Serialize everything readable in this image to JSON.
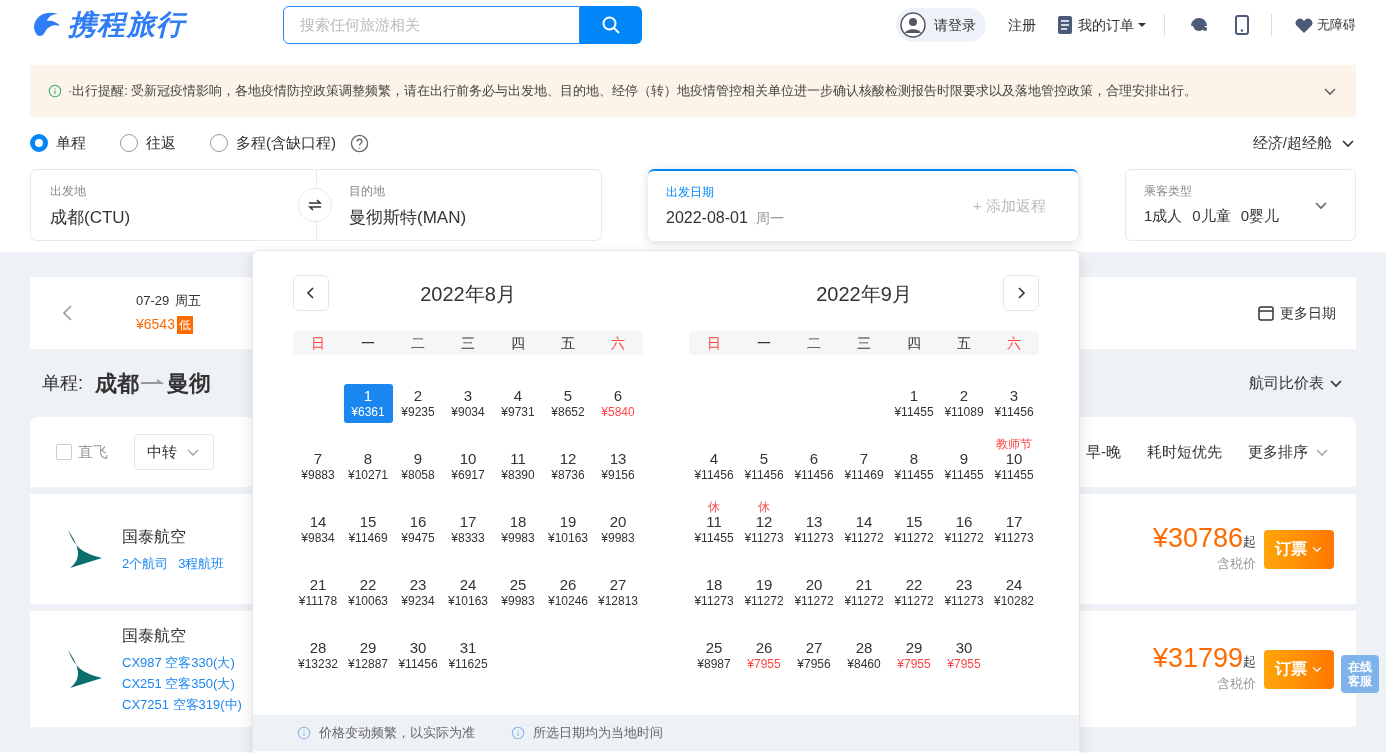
{
  "header": {
    "logo": "携程旅行",
    "search": {
      "placeholder": "搜索任何旅游相关"
    },
    "login": "请登录",
    "register": "注册",
    "orders": "我的订单",
    "accessibility": "无障碍"
  },
  "notice": {
    "text": "·出行提醒: 受新冠疫情影响，各地疫情防控政策调整频繁，请在出行前务必与出发地、目的地、经停（转）地疫情管控相关单位进一步确认核酸检测报告时限要求以及落地管控政策，合理安排出行。"
  },
  "trip_types": [
    {
      "label": "单程",
      "selected": true
    },
    {
      "label": "往返",
      "selected": false
    },
    {
      "label": "多程(含缺口程)",
      "selected": false
    }
  ],
  "cabin": "经济/超经舱",
  "search_form": {
    "from": {
      "label": "出发地",
      "value": "成都(CTU)"
    },
    "to": {
      "label": "目的地",
      "value": "曼彻斯特(MAN)"
    },
    "date": {
      "label": "出发日期",
      "value": "2022-08-01",
      "weekday": "周一",
      "return": "+ 添加返程"
    },
    "passengers": {
      "label": "乘客类型",
      "value": [
        "1成人",
        "0儿童",
        "0婴儿"
      ]
    }
  },
  "date_strip": {
    "date": "07-29",
    "weekday": "周五",
    "price": "¥6543",
    "badge": "低",
    "more": "更多日期"
  },
  "route": {
    "label": "单程:",
    "from": "成都",
    "to": "曼彻",
    "compare": "航司比价表"
  },
  "filters": {
    "direct": {
      "label": "直飞",
      "checked": false
    },
    "dropdowns": [
      "中转"
    ],
    "sorts": [
      "早-晚",
      "耗时短优先",
      "更多排序"
    ]
  },
  "flights": [
    {
      "airline": "国泰航空",
      "details": [
        "2个航司",
        "3程航班"
      ],
      "price": "¥30786",
      "suffix": "起",
      "tax": "含税价",
      "book": "订票"
    },
    {
      "airline": "国泰航空",
      "details": [
        "CX987 空客330(大)",
        "CX251 空客350(大)",
        "CX7251 空客319(中)"
      ],
      "price": "¥31799",
      "suffix": "起",
      "tax": "含税价",
      "book": "订票"
    }
  ],
  "service": "在线客服",
  "calendar": {
    "months": [
      {
        "title": "2022年8月",
        "weekdays": [
          {
            "label": "日",
            "weekend": true
          },
          {
            "label": "一",
            "weekend": false
          },
          {
            "label": "二",
            "weekend": false
          },
          {
            "label": "三",
            "weekend": false
          },
          {
            "label": "四",
            "weekend": false
          },
          {
            "label": "五",
            "weekend": false
          },
          {
            "label": "六",
            "weekend": true
          }
        ],
        "weeks": [
          {
            "align_end": true,
            "days": [
              {
                "day": "1",
                "price": "¥6361",
                "selected": true
              },
              {
                "day": "2",
                "price": "¥9235",
                "low": false,
                "selected": false
              },
              {
                "day": "3",
                "price": "¥9034",
                "low": false,
                "selected": false
              },
              {
                "day": "4",
                "price": "¥9731",
                "low": false,
                "selected": false
              },
              {
                "day": "5",
                "price": "¥8652",
                "low": false,
                "selected": false
              },
              {
                "day": "6",
                "price": "¥5840",
                "low": true,
                "selected": false
              }
            ]
          },
          {
            "days": [
              {
                "day": "7",
                "price": "¥9883",
                "low": false,
                "selected": false
              },
              {
                "day": "8",
                "price": "¥10271",
                "low": false,
                "selected": false
              },
              {
                "day": "9",
                "price": "¥8058",
                "low": false,
                "selected": false
              },
              {
                "day": "10",
                "price": "¥6917",
                "low": false,
                "selected": false
              },
              {
                "day": "11",
                "price": "¥8390",
                "low": false,
                "selected": false
              },
              {
                "day": "12",
                "price": "¥8736",
                "low": false,
                "selected": false
              },
              {
                "day": "13",
                "price": "¥9156",
                "low": false,
                "selected": false
              }
            ]
          },
          {
            "days": [
              {
                "day": "14",
                "price": "¥9834",
                "low": false,
                "selected": false
              },
              {
                "day": "15",
                "price": "¥11469",
                "low": false,
                "selected": false
              },
              {
                "day": "16",
                "price": "¥9475",
                "low": false,
                "selected": false
              },
              {
                "day": "17",
                "price": "¥8333",
                "low": false,
                "selected": false
              },
              {
                "day": "18",
                "price": "¥9983",
                "low": false,
                "selected": false
              },
              {
                "day": "19",
                "price": "¥10163",
                "low": false,
                "selected": false
              },
              {
                "day": "20",
                "price": "¥9983",
                "low": false,
                "selected": false
              }
            ]
          },
          {
            "days": [
              {
                "day": "21",
                "price": "¥11178",
                "low": false,
                "selected": false
              },
              {
                "day": "22",
                "price": "¥10063",
                "low": false,
                "selected": false
              },
              {
                "day": "23",
                "price": "¥9234",
                "low": false,
                "selected": false
              },
              {
                "day": "24",
                "price": "¥10163",
                "low": false,
                "selected": false
              },
              {
                "day": "25",
                "price": "¥9983",
                "low": false,
                "selected": false
              },
              {
                "day": "26",
                "price": "¥10246",
                "low": false,
                "selected": false
              },
              {
                "day": "27",
                "price": "¥12813",
                "low": false,
                "selected": false
              }
            ]
          },
          {
            "align_end": false,
            "days": [
              {
                "day": "28",
                "price": "¥13232",
                "low": false,
                "selected": false
              },
              {
                "day": "29",
                "price": "¥12887",
                "low": false,
                "selected": false
              },
              {
                "day": "30",
                "price": "¥11456",
                "low": false,
                "selected": false
              },
              {
                "day": "31",
                "price": "¥11625",
                "low": false,
                "selected": false
              }
            ]
          }
        ]
      },
      {
        "title": "2022年9月",
        "weekdays": [
          {
            "label": "日",
            "weekend": true
          },
          {
            "label": "一",
            "weekend": false
          },
          {
            "label": "二",
            "weekend": false
          },
          {
            "label": "三",
            "weekend": false
          },
          {
            "label": "四",
            "weekend": false
          },
          {
            "label": "五",
            "weekend": false
          },
          {
            "label": "六",
            "weekend": true
          }
        ],
        "weeks": [
          {
            "align_end": true,
            "days": [
              {
                "day": "1",
                "price": "¥11455",
                "low": false,
                "selected": false
              },
              {
                "day": "2",
                "price": "¥11089",
                "low": false,
                "selected": false
              },
              {
                "day": "3",
                "price": "¥11456",
                "low": false,
                "selected": false
              }
            ]
          },
          {
            "days": [
              {
                "day": "4",
                "price": "¥11456",
                "low": false,
                "selected": false
              },
              {
                "day": "5",
                "price": "¥11456",
                "low": false,
                "selected": false
              },
              {
                "day": "6",
                "price": "¥11456",
                "low": false,
                "selected": false
              },
              {
                "day": "7",
                "price": "¥11469",
                "low": false,
                "selected": false
              },
              {
                "day": "8",
                "price": "¥11455",
                "low": false,
                "selected": false
              },
              {
                "day": "9",
                "price": "¥11455",
                "low": false,
                "selected": false
              },
              {
                "day": "10",
                "price": "¥11455",
                "low": false,
                "selected": false,
                "note": "教师节"
              }
            ]
          },
          {
            "days": [
              {
                "day": "11",
                "price": "¥11455",
                "low": false,
                "selected": false,
                "note": "休"
              },
              {
                "day": "12",
                "price": "¥11273",
                "low": false,
                "selected": false,
                "note": "休"
              },
              {
                "day": "13",
                "price": "¥11273",
                "low": false,
                "selected": false
              },
              {
                "day": "14",
                "price": "¥11272",
                "low": false,
                "selected": false
              },
              {
                "day": "15",
                "price": "¥11272",
                "low": false,
                "selected": false
              },
              {
                "day": "16",
                "price": "¥11272",
                "low": false,
                "selected": false
              },
              {
                "day": "17",
                "price": "¥11273",
                "low": false,
                "selected": false
              }
            ]
          },
          {
            "days": [
              {
                "day": "18",
                "price": "¥11273",
                "low": false,
                "selected": false
              },
              {
                "day": "19",
                "price": "¥11272",
                "low": false,
                "selected": false
              },
              {
                "day": "20",
                "price": "¥11272",
                "low": false,
                "selected": false
              },
              {
                "day": "21",
                "price": "¥11272",
                "low": false,
                "selected": false
              },
              {
                "day": "22",
                "price": "¥11272",
                "low": false,
                "selected": false
              },
              {
                "day": "23",
                "price": "¥11273",
                "low": false,
                "selected": false
              },
              {
                "day": "24",
                "price": "¥10282",
                "low": false,
                "selected": false
              }
            ]
          },
          {
            "align_end": false,
            "days": [
              {
                "day": "25",
                "price": "¥8987",
                "low": false,
                "selected": false
              },
              {
                "day": "26",
                "price": "¥7955",
                "low": true,
                "selected": false
              },
              {
                "day": "27",
                "price": "¥7956",
                "low": false,
                "selected": false
              },
              {
                "day": "28",
                "price": "¥8460",
                "low": false,
                "selected": false
              },
              {
                "day": "29",
                "price": "¥7955",
                "low": true,
                "selected": false
              },
              {
                "day": "30",
                "price": "¥7955",
                "low": true,
                "selected": false
              }
            ]
          }
        ]
      }
    ],
    "footer": [
      "价格变动频繁，以实际为准",
      "所选日期均为当地时间"
    ]
  }
}
